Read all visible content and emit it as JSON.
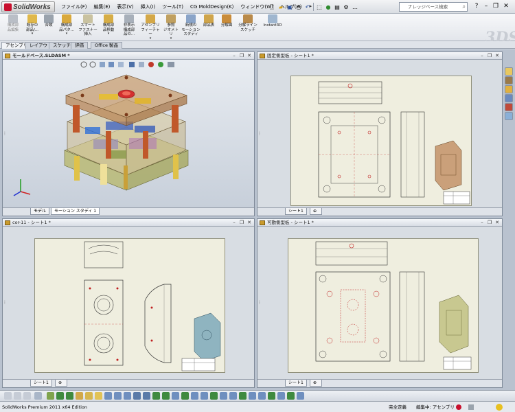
{
  "app": {
    "logo_text": "SolidWorks"
  },
  "menu": [
    {
      "label": "ファイル(F)"
    },
    {
      "label": "編集(E)"
    },
    {
      "label": "表示(V)"
    },
    {
      "label": "挿入(I)"
    },
    {
      "label": "ツール(T)"
    },
    {
      "label": "CG MoldDesign(K)"
    },
    {
      "label": "ウィンドウ(W)"
    },
    {
      "label": "ヘルプ(H)"
    }
  ],
  "search": {
    "placeholder": "ナレッジベース検索"
  },
  "command_manager": [
    {
      "label": "構成部\n品編集",
      "enabled": false
    },
    {
      "label": "既存の\n部品/..."
    },
    {
      "label": "合致"
    },
    {
      "label": "構成部\n品パタ..."
    },
    {
      "label": "スマート\nファスナー\n挿入"
    },
    {
      "label": "構成部\n品移動"
    },
    {
      "label": "非表示\n構成部\n品の..."
    },
    {
      "label": "アセンブリ\nフィーチャー"
    },
    {
      "label": "参照\nジオメトリ"
    },
    {
      "label": "新規の\nモーション\nスタディ"
    },
    {
      "label": "部品表"
    },
    {
      "label": "分解図"
    },
    {
      "label": "分解ライン\nスケッチ"
    },
    {
      "label": "Instant3D"
    }
  ],
  "tabs": [
    {
      "label": "アセンブリ"
    },
    {
      "label": "レイアウト"
    },
    {
      "label": "スケッチ"
    },
    {
      "label": "評価"
    },
    {
      "label": "Office 製品"
    }
  ],
  "windows": {
    "assembly": {
      "title": "モールドベース.SLDASM *",
      "tabs": [
        "モデル",
        "モーション スタディ 1"
      ]
    },
    "drawing_fixed": {
      "title": "固定側型板 - シート1 *",
      "sheet_tab": "シート1"
    },
    "drawing_core": {
      "title": "cor-11 - シート1 *",
      "sheet_tab": "シート1"
    },
    "drawing_moving": {
      "title": "可動側型板 - シート1 *",
      "sheet_tab": "シート1"
    }
  },
  "status": {
    "edition": "SolidWorks Premium 2011 x64 Edition",
    "definition": "完全定義",
    "editing": "編集中: アセンブリ"
  },
  "colors": {
    "accent": "#c8102e",
    "sheet": "#efeedf",
    "viewport": "#dfe4ea"
  }
}
